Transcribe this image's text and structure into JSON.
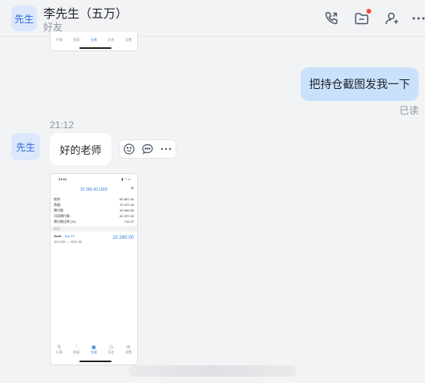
{
  "header": {
    "avatar_text": "先生",
    "contact_name": "李先生（五万）",
    "contact_tag": "好友",
    "icons": [
      "phone-icon",
      "folder-icon",
      "add-user-icon",
      "more-icon"
    ]
  },
  "messages": {
    "outgoing_text": "把持仓截图发我一下",
    "outgoing_status": "已读",
    "time": "21:12",
    "sender_avatar_text": "先生",
    "incoming_text": "好的老师",
    "action_icons": [
      "reaction-icon",
      "reply-icon",
      "more-icon"
    ]
  },
  "mini_screenshot": {
    "status_time": "21:11",
    "balance": "10 260.00 USD",
    "rows": [
      {
        "label": "结余:",
        "value": "60 967.40"
      },
      {
        "label": "净值:",
        "value": "71 227.40"
      },
      {
        "label": "预付款:",
        "value": "10 000.00"
      },
      {
        "label": "可用预付款:",
        "value": "61 227.40"
      },
      {
        "label": "预付款比率 (%):",
        "value": "712.27"
      }
    ],
    "section": "持仓",
    "position_symbol": "Gold",
    "position_side": "buy 10",
    "position_prices": "4014.85 → 4024.85",
    "position_profit": "10 260.00",
    "tabs": [
      "行情",
      "图表",
      "交易",
      "历史",
      "设置"
    ],
    "active_tab": "交易",
    "colors": {
      "accent": "#2f7bd8"
    }
  }
}
